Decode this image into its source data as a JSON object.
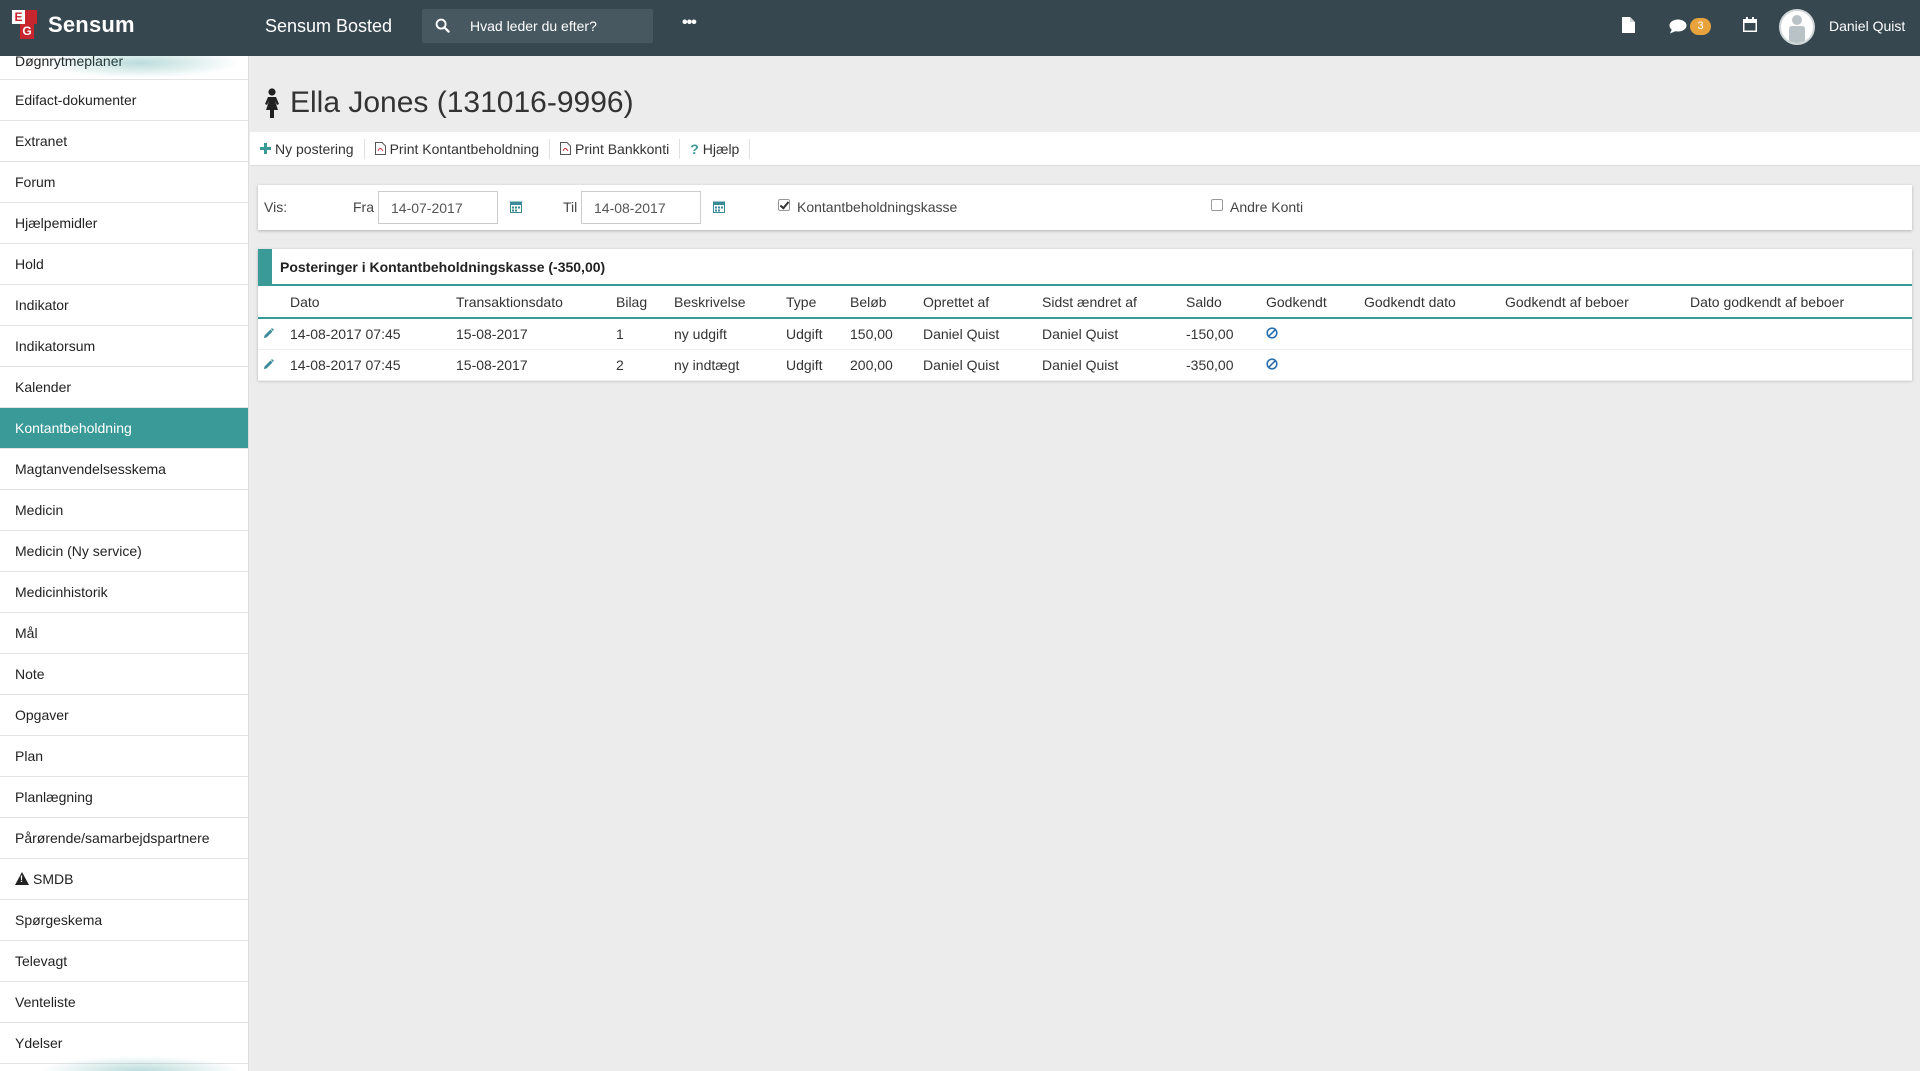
{
  "topbar": {
    "brand": "Sensum",
    "logo_letters": [
      "E",
      "G"
    ],
    "app_title": "Sensum Bosted",
    "search_placeholder": "Hvad leder du efter?",
    "more": "•••",
    "chat_badge": "3",
    "user_name": "Daniel Quist",
    "icons": [
      "document-icon",
      "chat-icon",
      "calendar-icon",
      "avatar"
    ]
  },
  "sidebar": {
    "items": [
      {
        "label": "Døgnrytmeplaner"
      },
      {
        "label": "Edifact-dokumenter"
      },
      {
        "label": "Extranet"
      },
      {
        "label": "Forum"
      },
      {
        "label": "Hjælpemidler"
      },
      {
        "label": "Hold"
      },
      {
        "label": "Indikator"
      },
      {
        "label": "Indikatorsum"
      },
      {
        "label": "Kalender"
      },
      {
        "label": "Kontantbeholdning",
        "active": true
      },
      {
        "label": "Magtanvendelsesskema"
      },
      {
        "label": "Medicin"
      },
      {
        "label": "Medicin (Ny service)"
      },
      {
        "label": "Medicinhistorik"
      },
      {
        "label": "Mål"
      },
      {
        "label": "Note"
      },
      {
        "label": "Opgaver"
      },
      {
        "label": "Plan"
      },
      {
        "label": "Planlægning"
      },
      {
        "label": "Pårørende/samarbejdspartnere"
      },
      {
        "label": "SMDB",
        "icon": "warning-icon"
      },
      {
        "label": "Spørgeskema"
      },
      {
        "label": "Televagt"
      },
      {
        "label": "Venteliste"
      },
      {
        "label": "Ydelser"
      }
    ]
  },
  "page": {
    "title": "Ella Jones (131016-9996)",
    "actions": {
      "new_posting": "Ny postering",
      "print_cash": "Print Kontantbeholdning",
      "print_bank": "Print Bankkonti",
      "help": "Hjælp"
    }
  },
  "filter": {
    "show_label": "Vis:",
    "from_label": "Fra",
    "from_value": "14-07-2017",
    "to_label": "Til",
    "to_value": "14-08-2017",
    "cash_label": "Kontantbeholdningskasse",
    "cash_checked": true,
    "other_label": "Andre Konti",
    "other_checked": false
  },
  "postings": {
    "title": "Posteringer i Kontantbeholdningskasse (-350,00)",
    "columns": [
      "Dato",
      "Transaktionsdato",
      "Bilag",
      "Beskrivelse",
      "Type",
      "Beløb",
      "Oprettet af",
      "Sidst ændret af",
      "Saldo",
      "Godkendt",
      "Godkendt dato",
      "Godkendt af beboer",
      "Dato godkendt af beboer"
    ],
    "rows": [
      {
        "dato": "14-08-2017 07:45",
        "transaktionsdato": "15-08-2017",
        "bilag": "1",
        "beskrivelse": "ny udgift",
        "type": "Udgift",
        "beloeb": "150,00",
        "oprettet_af": "Daniel Quist",
        "sidst_aendret_af": "Daniel Quist",
        "saldo": "-150,00",
        "godkendt": "not-approved-icon"
      },
      {
        "dato": "14-08-2017 07:45",
        "transaktionsdato": "15-08-2017",
        "bilag": "2",
        "beskrivelse": "ny indtægt",
        "type": "Udgift",
        "beloeb": "200,00",
        "oprettet_af": "Daniel Quist",
        "sidst_aendret_af": "Daniel Quist",
        "saldo": "-350,00",
        "godkendt": "not-approved-icon"
      }
    ]
  },
  "colors": {
    "topbar": "#36474f",
    "accent": "#3a9a98",
    "badge": "#e8a33d",
    "brand_red": "#c8262e"
  }
}
